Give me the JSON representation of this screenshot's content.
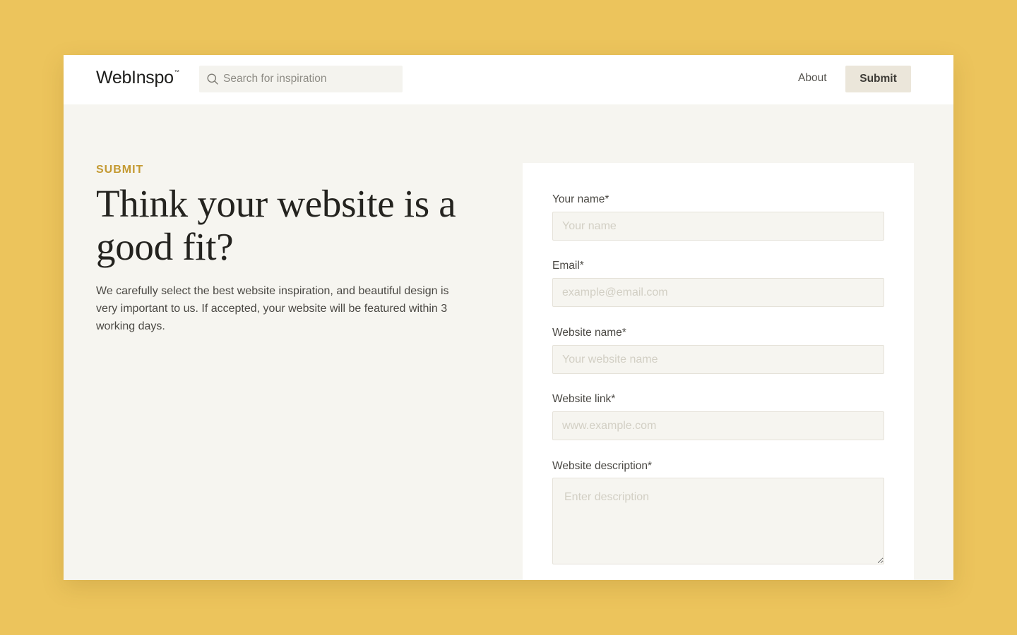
{
  "header": {
    "logo": "WebInspo",
    "logo_mark": "™",
    "search_placeholder": "Search for inspiration",
    "search_icon": "search-icon",
    "nav_about": "About",
    "nav_submit": "Submit"
  },
  "intro": {
    "eyebrow": "SUBMIT",
    "headline": "Think your website is a good fit?",
    "body": "We carefully select the best website inspiration, and beautiful design is very important to us. If accepted, your website will be featured within 3 working days."
  },
  "form": {
    "name_label": "Your name*",
    "name_placeholder": "Your name",
    "email_label": "Email*",
    "email_placeholder": "example@email.com",
    "website_name_label": "Website name*",
    "website_name_placeholder": "Your website name",
    "website_link_label": "Website link*",
    "website_link_placeholder": "www.example.com",
    "description_label": "Website description*",
    "description_placeholder": "Enter description"
  },
  "colors": {
    "page_background": "#ecc45c",
    "content_background": "#f6f5f0",
    "accent": "#c49a32",
    "submit_button": "#ebe6da"
  }
}
